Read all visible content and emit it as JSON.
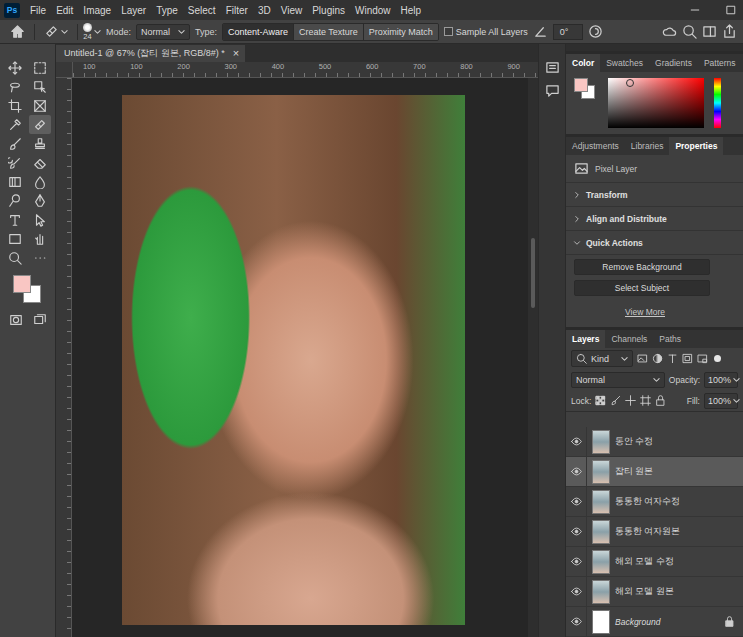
{
  "app": {
    "logo": "Ps"
  },
  "menu": [
    "File",
    "Edit",
    "Image",
    "Layer",
    "Type",
    "Select",
    "Filter",
    "3D",
    "View",
    "Plugins",
    "Window",
    "Help"
  ],
  "options_bar": {
    "brush_size": "24",
    "mode_label": "Mode:",
    "mode": "Normal",
    "type_label": "Type:",
    "type_buttons": [
      {
        "label": "Content-Aware",
        "selected": true
      },
      {
        "label": "Create Texture",
        "selected": false
      },
      {
        "label": "Proximity Match",
        "selected": false
      }
    ],
    "sample_all_layers": {
      "label": "Sample All Layers",
      "checked": false
    },
    "angle": "0°"
  },
  "toolbar": {
    "tools": [
      {
        "selected": false
      },
      {
        "selected": false
      },
      {
        "selected": false
      },
      {
        "selected": false
      },
      {
        "selected": false
      },
      {
        "selected": false
      },
      {
        "selected": false
      },
      {
        "selected": true
      },
      {
        "selected": false
      },
      {
        "selected": false
      },
      {
        "selected": false
      },
      {
        "selected": false
      },
      {
        "selected": false
      },
      {
        "selected": false
      },
      {
        "selected": false
      },
      {
        "selected": false
      },
      {
        "selected": false
      },
      {
        "selected": false
      },
      {
        "selected": false
      },
      {
        "selected": false
      },
      {
        "selected": false
      },
      {
        "selected": false
      }
    ],
    "foreground_color": "#f9c6c3",
    "background_color": "#ffffff"
  },
  "document": {
    "tab": "Untitled-1 @ 67% (잡티 원본, RGB/8#) *",
    "close": "×",
    "ruler_labels": [
      "100",
      "100",
      "200",
      "300",
      "400",
      "500",
      "600",
      "700",
      "800",
      "900"
    ]
  },
  "color_panel": {
    "tabs": [
      {
        "label": "Color",
        "selected": true
      },
      {
        "label": "Swatches",
        "selected": false
      },
      {
        "label": "Gradients",
        "selected": false
      },
      {
        "label": "Patterns",
        "selected": false
      }
    ],
    "foreground_color": "#f9c6c3",
    "background_color": "#ffffff"
  },
  "properties_panel": {
    "tabs": [
      {
        "label": "Adjustments",
        "selected": false
      },
      {
        "label": "Libraries",
        "selected": false
      },
      {
        "label": "Properties",
        "selected": true
      }
    ],
    "layer_kind": "Pixel Layer",
    "sections": [
      {
        "label": "Transform",
        "expanded": false
      },
      {
        "label": "Align and Distribute",
        "expanded": false
      },
      {
        "label": "Quick Actions",
        "expanded": true
      }
    ],
    "quick_actions": [
      "Remove Background",
      "Select Subject"
    ],
    "link": "View More"
  },
  "layers_panel": {
    "tabs": [
      {
        "label": "Layers",
        "selected": true
      },
      {
        "label": "Channels",
        "selected": false
      },
      {
        "label": "Paths",
        "selected": false
      }
    ],
    "filter": "Kind",
    "blend_mode": "Normal",
    "opacity_label": "Opacity:",
    "opacity": "100%",
    "lock_label": "Lock:",
    "fill_label": "Fill:",
    "fill": "100%",
    "layers": [
      {
        "name": "동안 수정",
        "visible": true,
        "selected": false,
        "locked": false,
        "kind": "pixel"
      },
      {
        "name": "잡티 원본",
        "visible": true,
        "selected": true,
        "locked": false,
        "kind": "pixel"
      },
      {
        "name": "통통한 여자수정",
        "visible": true,
        "selected": false,
        "locked": false,
        "kind": "pixel"
      },
      {
        "name": "통통한 여자원본",
        "visible": true,
        "selected": false,
        "locked": false,
        "kind": "pixel"
      },
      {
        "name": "해외 모델 수정",
        "visible": true,
        "selected": false,
        "locked": false,
        "kind": "pixel"
      },
      {
        "name": "해외 모델 원본",
        "visible": true,
        "selected": false,
        "locked": false,
        "kind": "pixel"
      },
      {
        "name": "Background",
        "visible": true,
        "selected": false,
        "locked": true,
        "kind": "background"
      }
    ]
  }
}
